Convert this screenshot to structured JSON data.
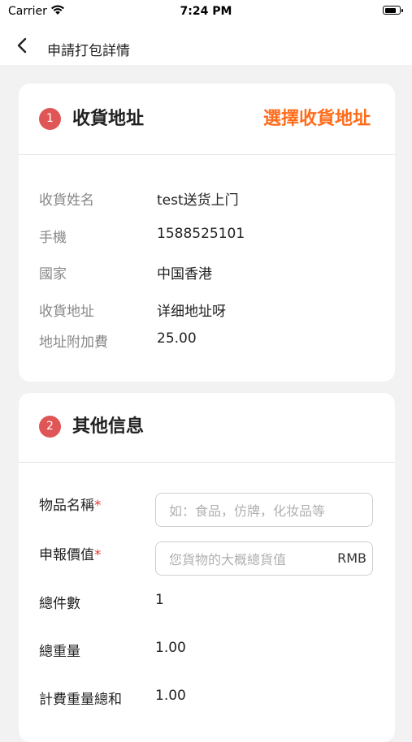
{
  "status_bar": {
    "carrier": "Carrier",
    "time": "7:24 PM"
  },
  "nav": {
    "title": "申請打包詳情"
  },
  "address_section": {
    "step": "1",
    "title": "收貨地址",
    "select_link": "選擇收貨地址",
    "rows": [
      {
        "label": "收貨姓名",
        "value": "test送货上门"
      },
      {
        "label": "手機",
        "value": "1588525101"
      },
      {
        "label": "國家",
        "value": "中国香港"
      },
      {
        "label": "收貨地址",
        "value": "详细地址呀"
      },
      {
        "label": "地址附加費",
        "value": "25.00"
      }
    ]
  },
  "other_section": {
    "step": "2",
    "title": "其他信息",
    "item_name": {
      "label": "物品名稱",
      "required": "*",
      "placeholder": "如：食品，仿牌，化妆品等",
      "value": ""
    },
    "declared_value": {
      "label": "申報價值",
      "required": "*",
      "placeholder": "您貨物的大概總貨值",
      "unit": "RMB",
      "value": ""
    },
    "total_pieces": {
      "label": "總件數",
      "value": "1"
    },
    "total_weight": {
      "label": "總重量",
      "value": "1.00"
    },
    "billable_weight": {
      "label": "計費重量總和",
      "value": "1.00"
    }
  }
}
